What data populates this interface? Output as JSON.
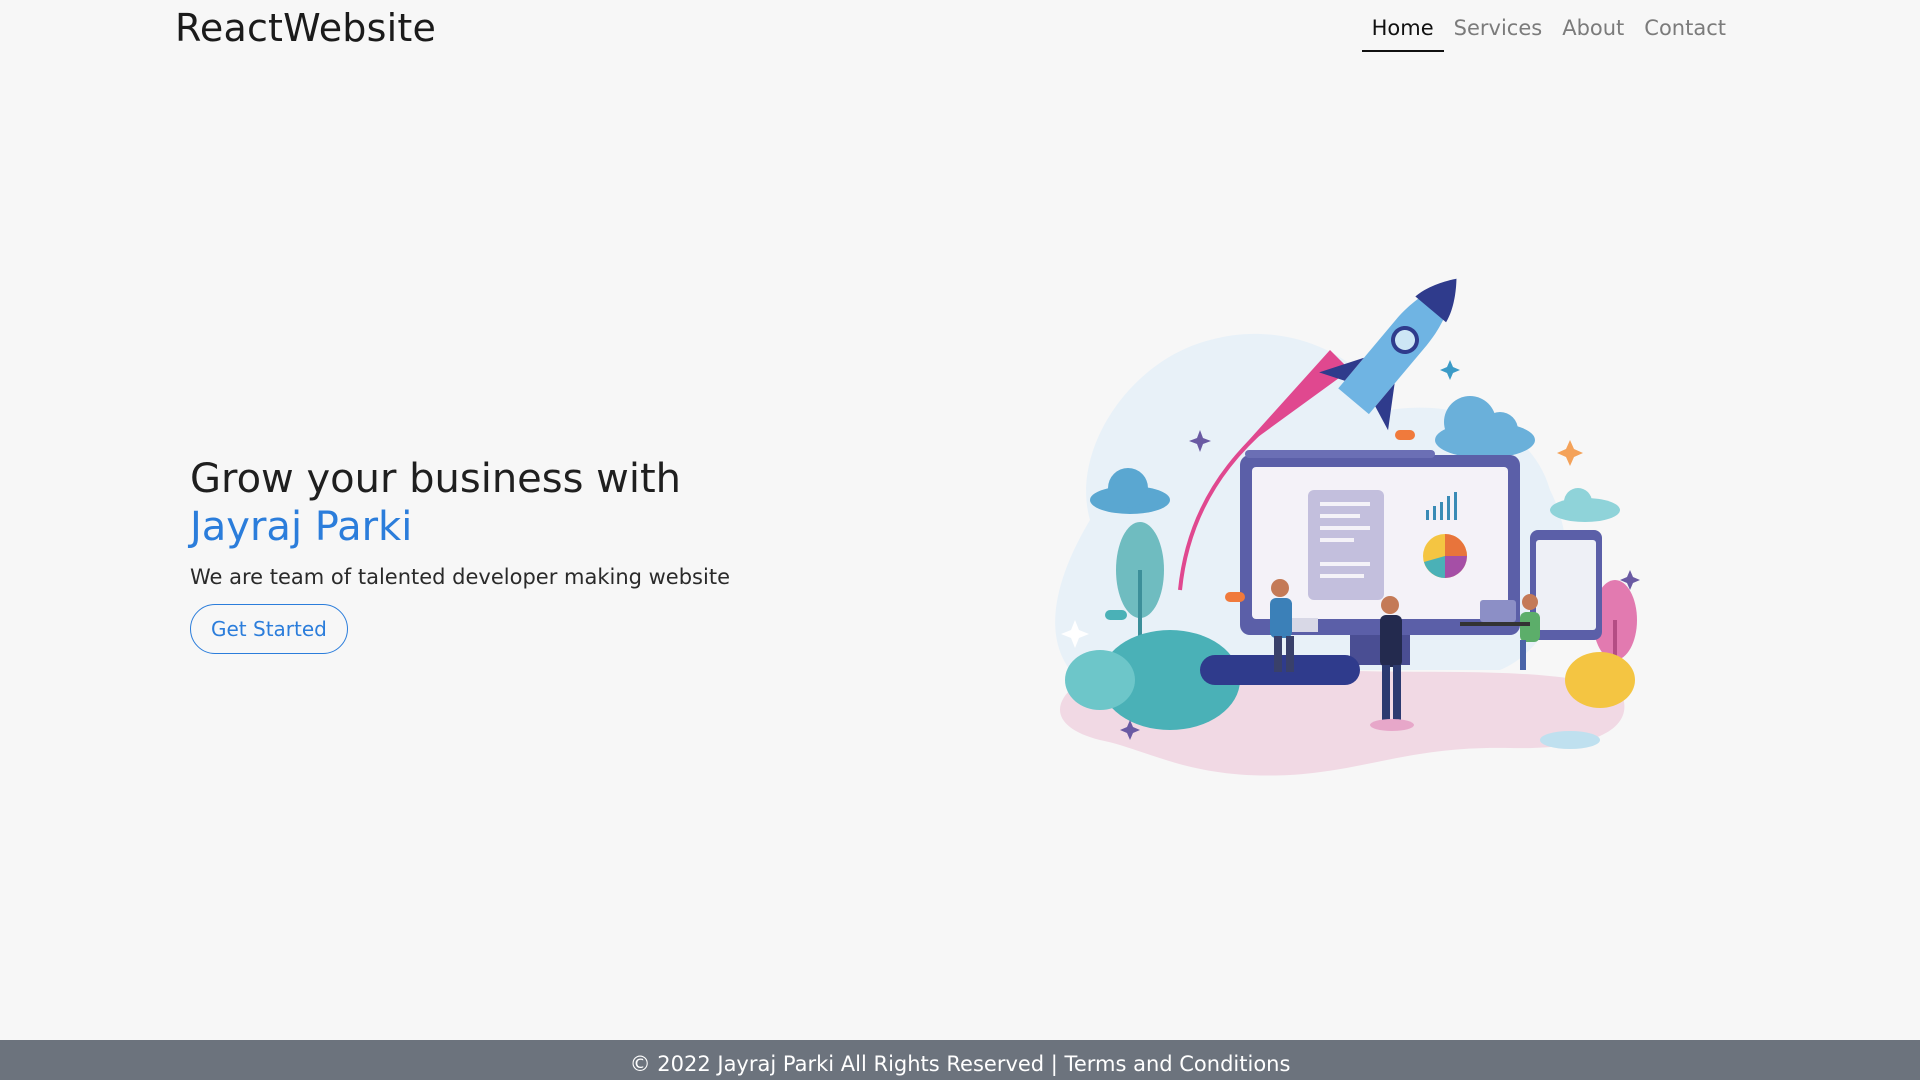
{
  "navbar": {
    "brand": "ReactWebsite",
    "links": [
      {
        "label": "Home",
        "active": true
      },
      {
        "label": "Services",
        "active": false
      },
      {
        "label": "About",
        "active": false
      },
      {
        "label": "Contact",
        "active": false
      }
    ]
  },
  "hero": {
    "title": "Grow your business with",
    "brand_name": "Jayraj Parki",
    "subtitle": "We are team of talented developer making website",
    "cta_label": "Get Started"
  },
  "footer": {
    "text": "© 2022 Jayraj Parki All Rights Reserved | Terms and Conditions"
  },
  "colors": {
    "background": "#f7f7f7",
    "accent": "#2b7ddb",
    "footer_bg": "#6c737d"
  }
}
